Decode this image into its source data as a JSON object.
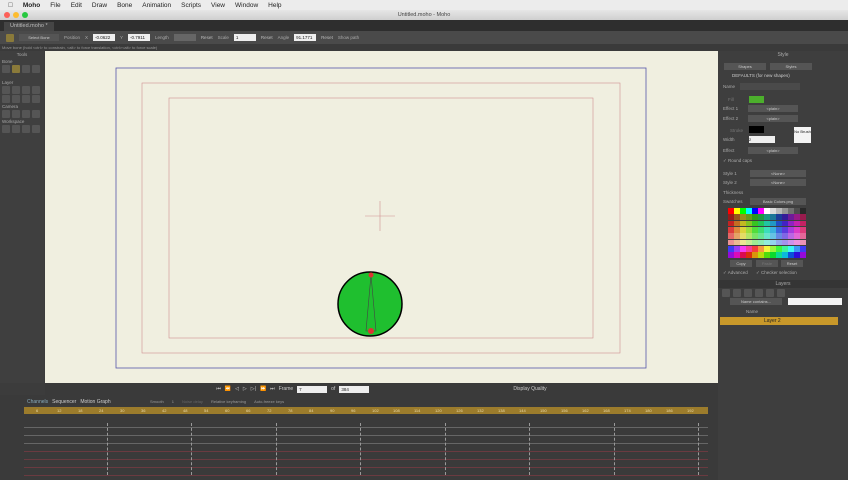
{
  "menubar": {
    "apple": "",
    "app": "Moho",
    "items": [
      "File",
      "Edit",
      "Draw",
      "Bone",
      "Animation",
      "Scripts",
      "View",
      "Window",
      "Help"
    ]
  },
  "window": {
    "title": "Untitled.moho - Moho",
    "tab": "Untitled.moho *"
  },
  "options": {
    "tool_select": "Select Bone",
    "position_label": "Position",
    "x_label": "X",
    "x_value": "-0.0622",
    "y_label": "Y",
    "y_value": "-0.7911",
    "length_label": "Length",
    "reset1": "Reset",
    "scale_label": "Scale",
    "scale_value": "1",
    "reset2": "Reset",
    "angle_label": "Angle",
    "angle_value": "91.1771",
    "reset3": "Reset",
    "show_path": "Show path",
    "frame_label": "Frame: 7"
  },
  "hint": "Move bone (hold <ctrl> to constrain, <alt> to force translation, <ctrl><alt> to force scale)",
  "tools": {
    "title": "Tools",
    "sections": [
      "Bone",
      "Layer",
      "Camera",
      "Workspace"
    ]
  },
  "style": {
    "title": "Style",
    "shapes": "Shapes",
    "styles": "Styles",
    "defaults": "DEFAULTS (for new shapes)",
    "name_label": "Name",
    "fill_label": "Fill",
    "effect1_label": "Effect 1",
    "effect1": "<plain>",
    "effect2_label": "Effect 2",
    "effect2": "<plain>",
    "stroke_label": "Stroke",
    "width_label": "Width",
    "width_value": "2",
    "effect_label": "Effect",
    "effect": "<plain>",
    "no_brush": "No Brush",
    "round_caps": "Round caps",
    "style1_label": "Style 1",
    "style1": "<None>",
    "style2_label": "Style 2",
    "style2": "<None>",
    "thickness_label": "Thickness",
    "swatches_label": "Swatches",
    "swatches": "Basic Colors.png",
    "copy": "Copy",
    "paste": "Paste",
    "reset": "Reset",
    "advanced": "Advanced",
    "checker": "Checker selection",
    "fill_color": "#4caf2c",
    "stroke_color": "#000000"
  },
  "layers": {
    "title": "Layers",
    "filter": "Name contains...",
    "name_col": "Name",
    "items": [
      {
        "name": "Layer 2"
      }
    ]
  },
  "playback": {
    "frame_label": "Frame",
    "frame": "7",
    "of_label": "of",
    "total": "384",
    "quality": "Display Quality"
  },
  "timeline": {
    "tabs": [
      "Channels",
      "Sequencer",
      "Motion Graph"
    ],
    "interp": "Smooth",
    "interp_n": "1",
    "relative": "Relative keyframing",
    "autofreeze": "Auto-freeze keys",
    "noise": "Noise delay",
    "ruler": [
      "6",
      "12",
      "18",
      "24",
      "30",
      "36",
      "42",
      "48",
      "54",
      "60",
      "66",
      "72",
      "78",
      "84",
      "90",
      "96",
      "102",
      "108",
      "114",
      "120",
      "126",
      "132",
      "138",
      "144",
      "150",
      "156",
      "162",
      "168",
      "174",
      "180",
      "186",
      "192"
    ]
  }
}
